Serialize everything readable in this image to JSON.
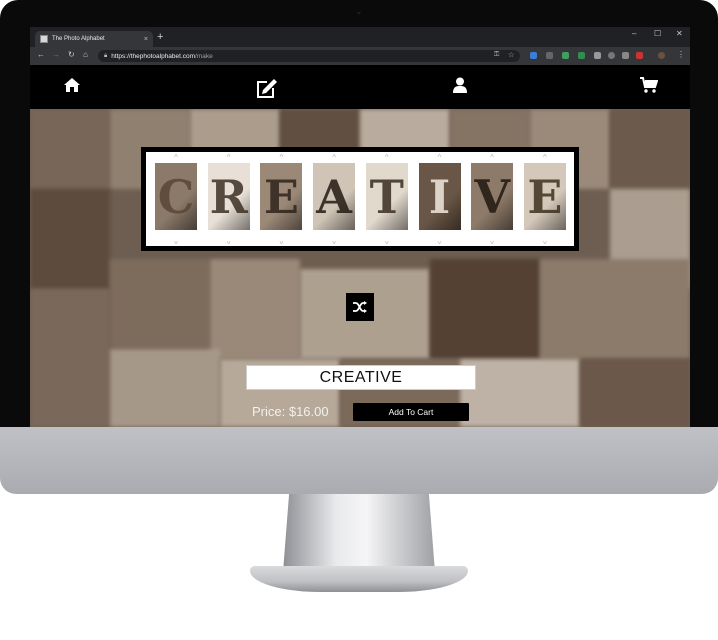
{
  "browser": {
    "tab_title": "The Photo Alphabet",
    "tab_close": "×",
    "new_tab": "+",
    "url_domain": "https://thephotoalphabet.com",
    "url_path": "/make",
    "window_controls": [
      "–",
      "☐",
      "✕"
    ]
  },
  "site_nav": {
    "icons": [
      "home-icon",
      "edit-icon",
      "user-icon",
      "cart-icon"
    ]
  },
  "builder": {
    "letters": [
      "C",
      "R",
      "E",
      "A",
      "T",
      "I",
      "V",
      "E"
    ],
    "word": "CREATIVE",
    "price": "Price: $16.00",
    "add_to_cart": "Add To Cart"
  },
  "colors": {
    "sepia_dark": "#4a3a2e",
    "sepia_light": "#e7dccf",
    "bezel": "#0a0a0a"
  }
}
